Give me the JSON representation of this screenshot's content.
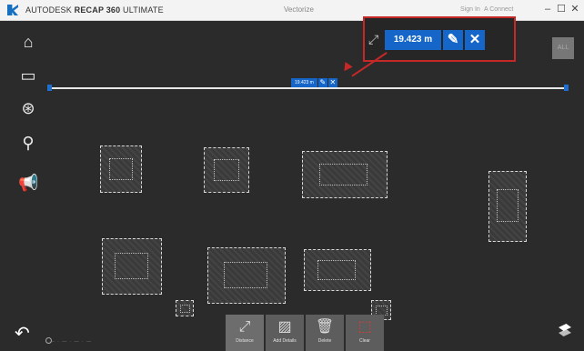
{
  "window": {
    "app_name_prefix": "AUTODESK",
    "app_name_bold": "RECAP 360",
    "app_name_suffix": "ULTIMATE",
    "document_title": "Vectorize",
    "sign_in": "Sign In",
    "connect": "A Connect"
  },
  "measurement": {
    "value": "19.423 m",
    "small_value": "19.423 m"
  },
  "toolbar": {
    "items": [
      {
        "label": "Distance",
        "icon": "ruler-icon"
      },
      {
        "label": "Add Details",
        "icon": "image-add-icon"
      },
      {
        "label": "Delete",
        "icon": "trash-icon"
      },
      {
        "label": "Clear",
        "icon": "clear-icon"
      }
    ]
  },
  "corner_button": "ALL"
}
